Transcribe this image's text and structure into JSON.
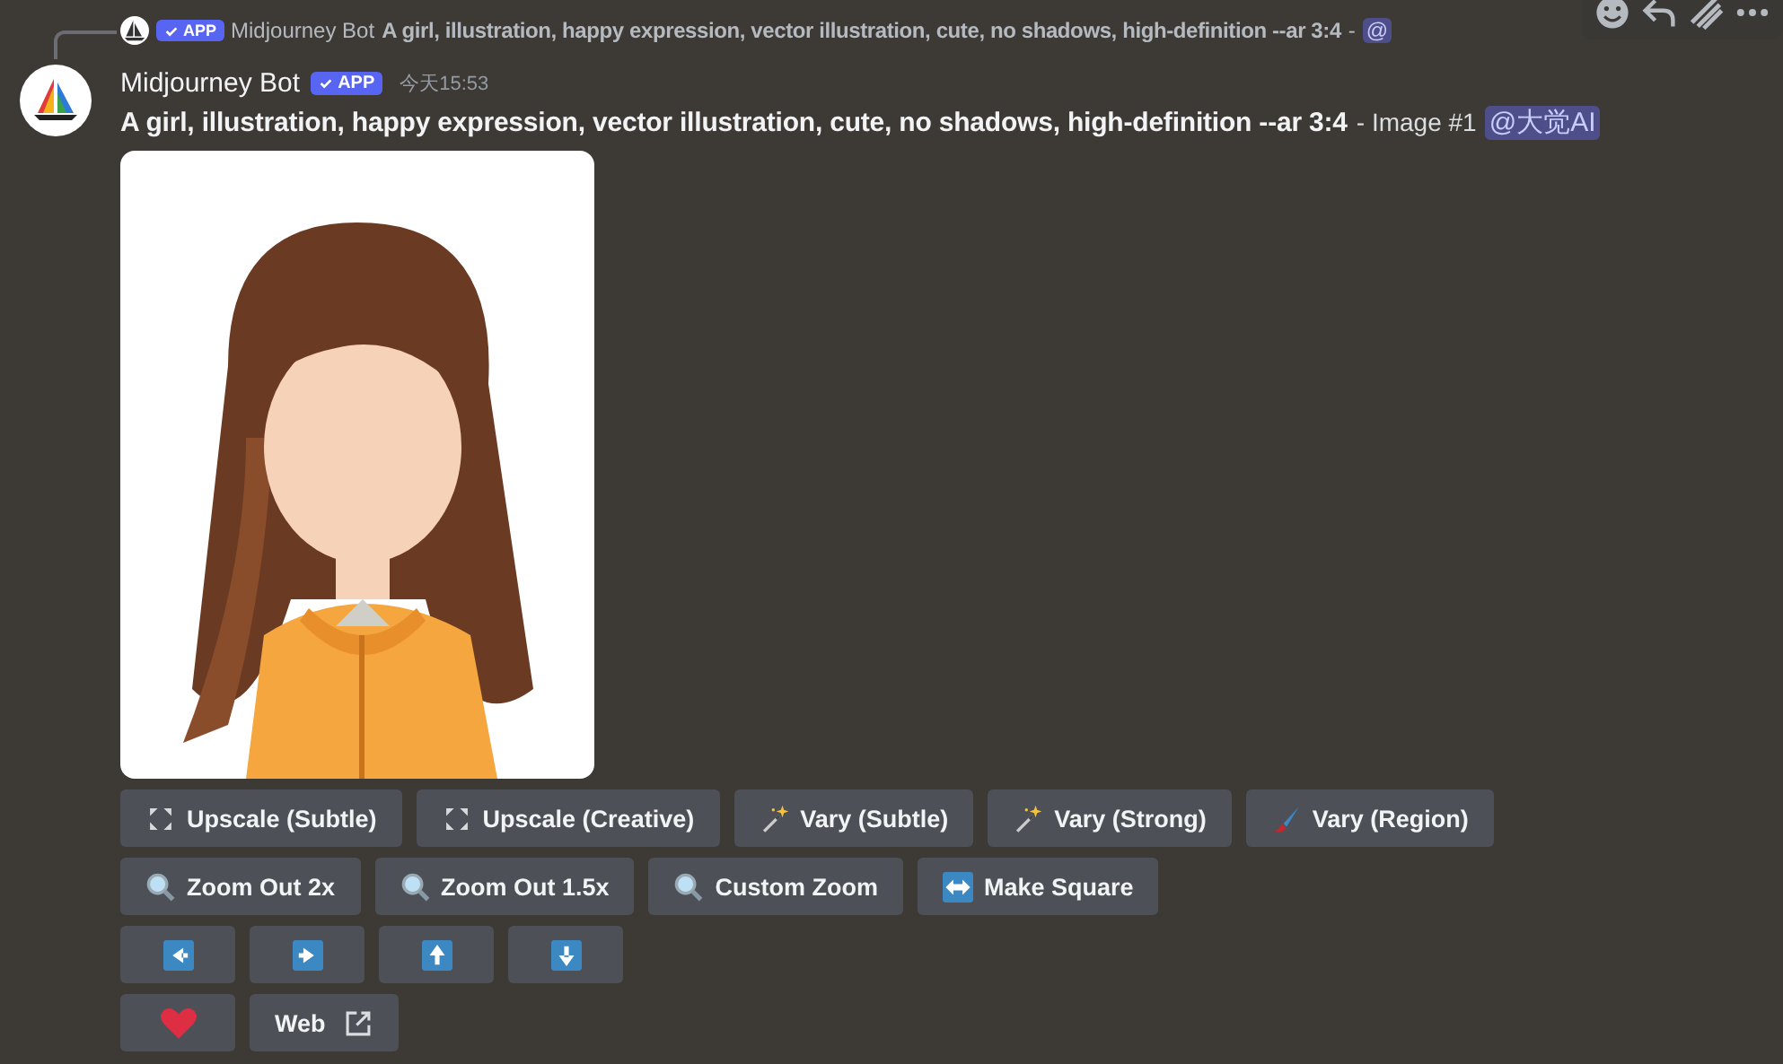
{
  "reply": {
    "author": "Midjourney Bot",
    "badge": "APP",
    "text": "A girl, illustration, happy expression, vector illustration, cute, no shadows, high-definition --ar 3:4",
    "separator": "-",
    "mention": "@"
  },
  "hover_toolbar": [
    {
      "kind": "emoji"
    },
    {
      "kind": "reply"
    },
    {
      "kind": "app"
    },
    {
      "kind": "more"
    }
  ],
  "message": {
    "author": "Midjourney Bot",
    "badge": "APP",
    "time": "今天15:53",
    "prompt": "A girl, illustration, happy expression, vector illustration, cute, no shadows, high-definition --ar 3:4",
    "suffix": "- Image #1",
    "mention": "@大觉AI"
  },
  "button_rows": [
    [
      {
        "kind": "expand",
        "label": "Upscale (Subtle)"
      },
      {
        "kind": "expand",
        "label": "Upscale (Creative)"
      },
      {
        "kind": "wand",
        "label": "Vary (Subtle)"
      },
      {
        "kind": "wand",
        "label": "Vary (Strong)"
      },
      {
        "kind": "brush",
        "label": "Vary (Region)"
      }
    ],
    [
      {
        "kind": "magnifier",
        "label": "Zoom Out 2x"
      },
      {
        "kind": "magnifier",
        "label": "Zoom Out 1.5x"
      },
      {
        "kind": "magnifier",
        "label": "Custom Zoom"
      },
      {
        "kind": "swap",
        "label": "Make Square"
      }
    ],
    [
      {
        "kind": "left"
      },
      {
        "kind": "right"
      },
      {
        "kind": "up"
      },
      {
        "kind": "down"
      }
    ],
    [
      {
        "kind": "heart"
      },
      {
        "kind": "link",
        "label": "Web"
      }
    ]
  ]
}
